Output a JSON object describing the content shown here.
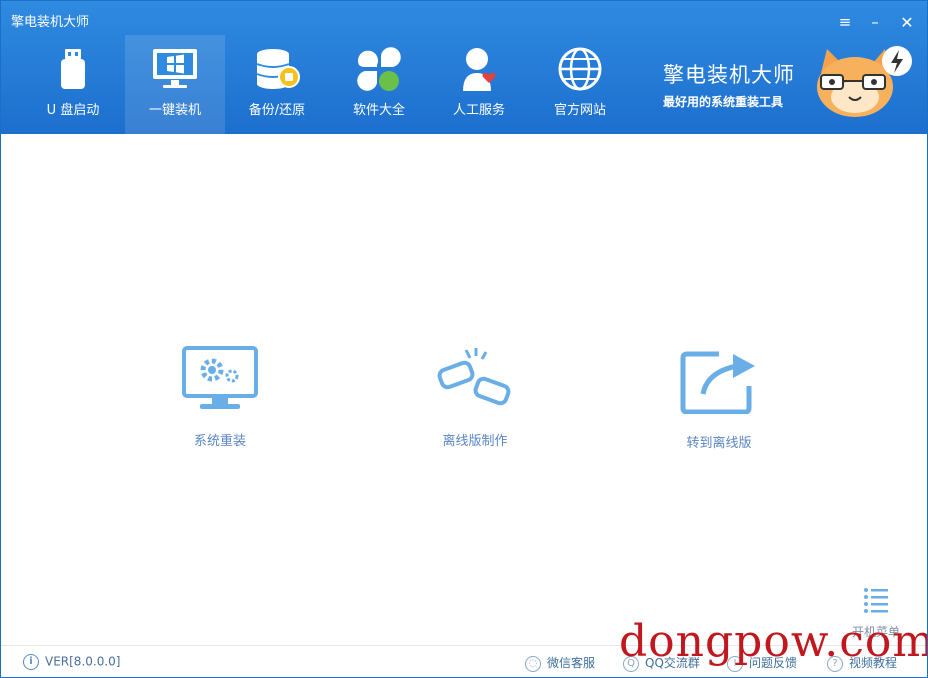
{
  "window": {
    "title": "擎电装机大师",
    "controls": {
      "menu_icon": "≡",
      "minimize_icon": "–",
      "close_icon": "✕"
    }
  },
  "nav": {
    "items": [
      {
        "label": "U 盘启动",
        "icon": "usb-drive-icon"
      },
      {
        "label": "一键装机",
        "icon": "monitor-windows-icon",
        "active": true
      },
      {
        "label": "备份/还原",
        "icon": "database-backup-icon"
      },
      {
        "label": "软件大全",
        "icon": "clover-apps-icon"
      },
      {
        "label": "人工服务",
        "icon": "person-heart-icon"
      },
      {
        "label": "官方网站",
        "icon": "globe-icon"
      }
    ]
  },
  "brand": {
    "name": "擎电装机大师",
    "tagline": "最好用的系统重装工具"
  },
  "actions": [
    {
      "label": "系统重装",
      "icon": "monitor-gears-icon"
    },
    {
      "label": "离线版制作",
      "icon": "broken-link-icon"
    },
    {
      "label": "转到离线版",
      "icon": "share-arrow-icon"
    }
  ],
  "boot_menu": {
    "label": "开机菜单",
    "icon": "list-icon"
  },
  "statusbar": {
    "version": "VER[8.0.0.0]",
    "links": [
      {
        "label": "微信客服",
        "icon": "wechat-icon"
      },
      {
        "label": "QQ交流群",
        "icon": "qq-icon"
      },
      {
        "label": "问题反馈",
        "icon": "feedback-icon"
      },
      {
        "label": "视频教程",
        "icon": "help-icon"
      }
    ]
  },
  "watermark": "dongpow.com",
  "colors": {
    "header_blue": "#2f8ae0",
    "action_blue": "#6aaee8",
    "watermark_red": "#c0181e"
  }
}
